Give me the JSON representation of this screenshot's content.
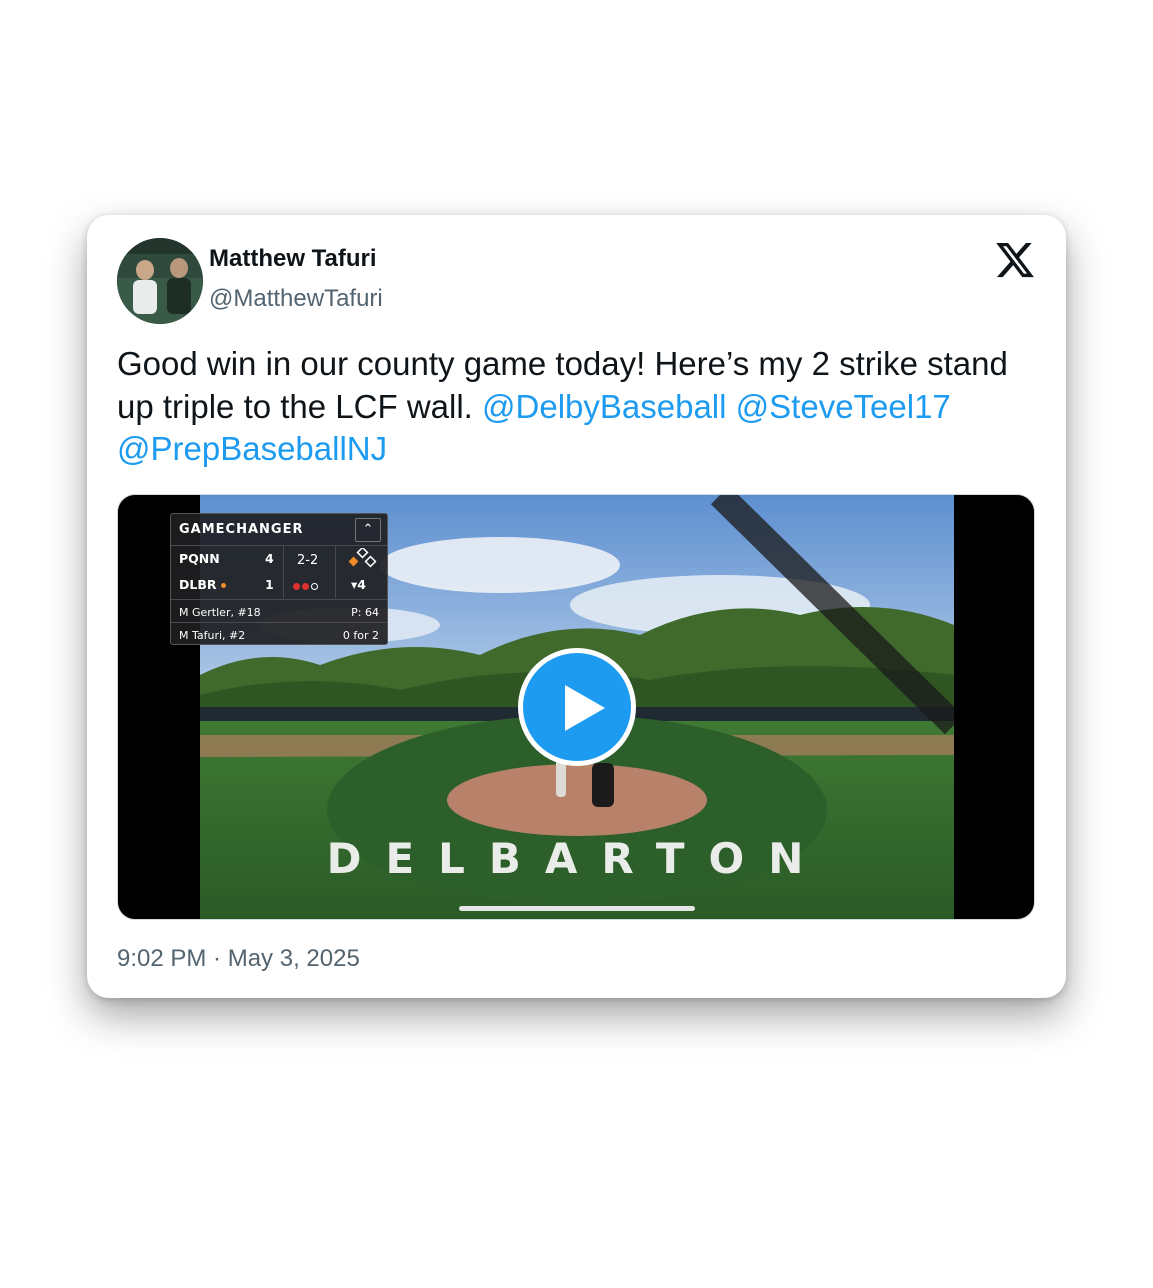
{
  "tweet": {
    "author_name": "Matthew Tafuri",
    "author_handle": "@MatthewTafuri",
    "text_plain": "Good win in our county game today! Here’s my 2 strike stand up triple to the LCF wall.",
    "mentions": [
      "@DelbyBaseball",
      "@SteveTeel17",
      "@PrepBaseballNJ"
    ],
    "timestamp": "9:02 PM · May 3, 2025"
  },
  "icons": {
    "logo": "x-logo-icon",
    "play": "play-icon",
    "collapse": "chevron-up-icon"
  },
  "scoreboard": {
    "title": "GAMECHANGER",
    "team1": "PQNN",
    "team1_score": "4",
    "team2": "DLBR",
    "team2_score": "1",
    "count": "2-2",
    "inning": "▾4",
    "pitcher": "M Gertler, #18",
    "pitch_count": "P: 64",
    "batter": "M Tafuri, #2",
    "batter_stats": "0 for 2"
  },
  "field": {
    "lettering": "DELBARTON"
  },
  "colors": {
    "link": "#1d9bf0",
    "text": "#0f1419",
    "secondary": "#536471"
  }
}
